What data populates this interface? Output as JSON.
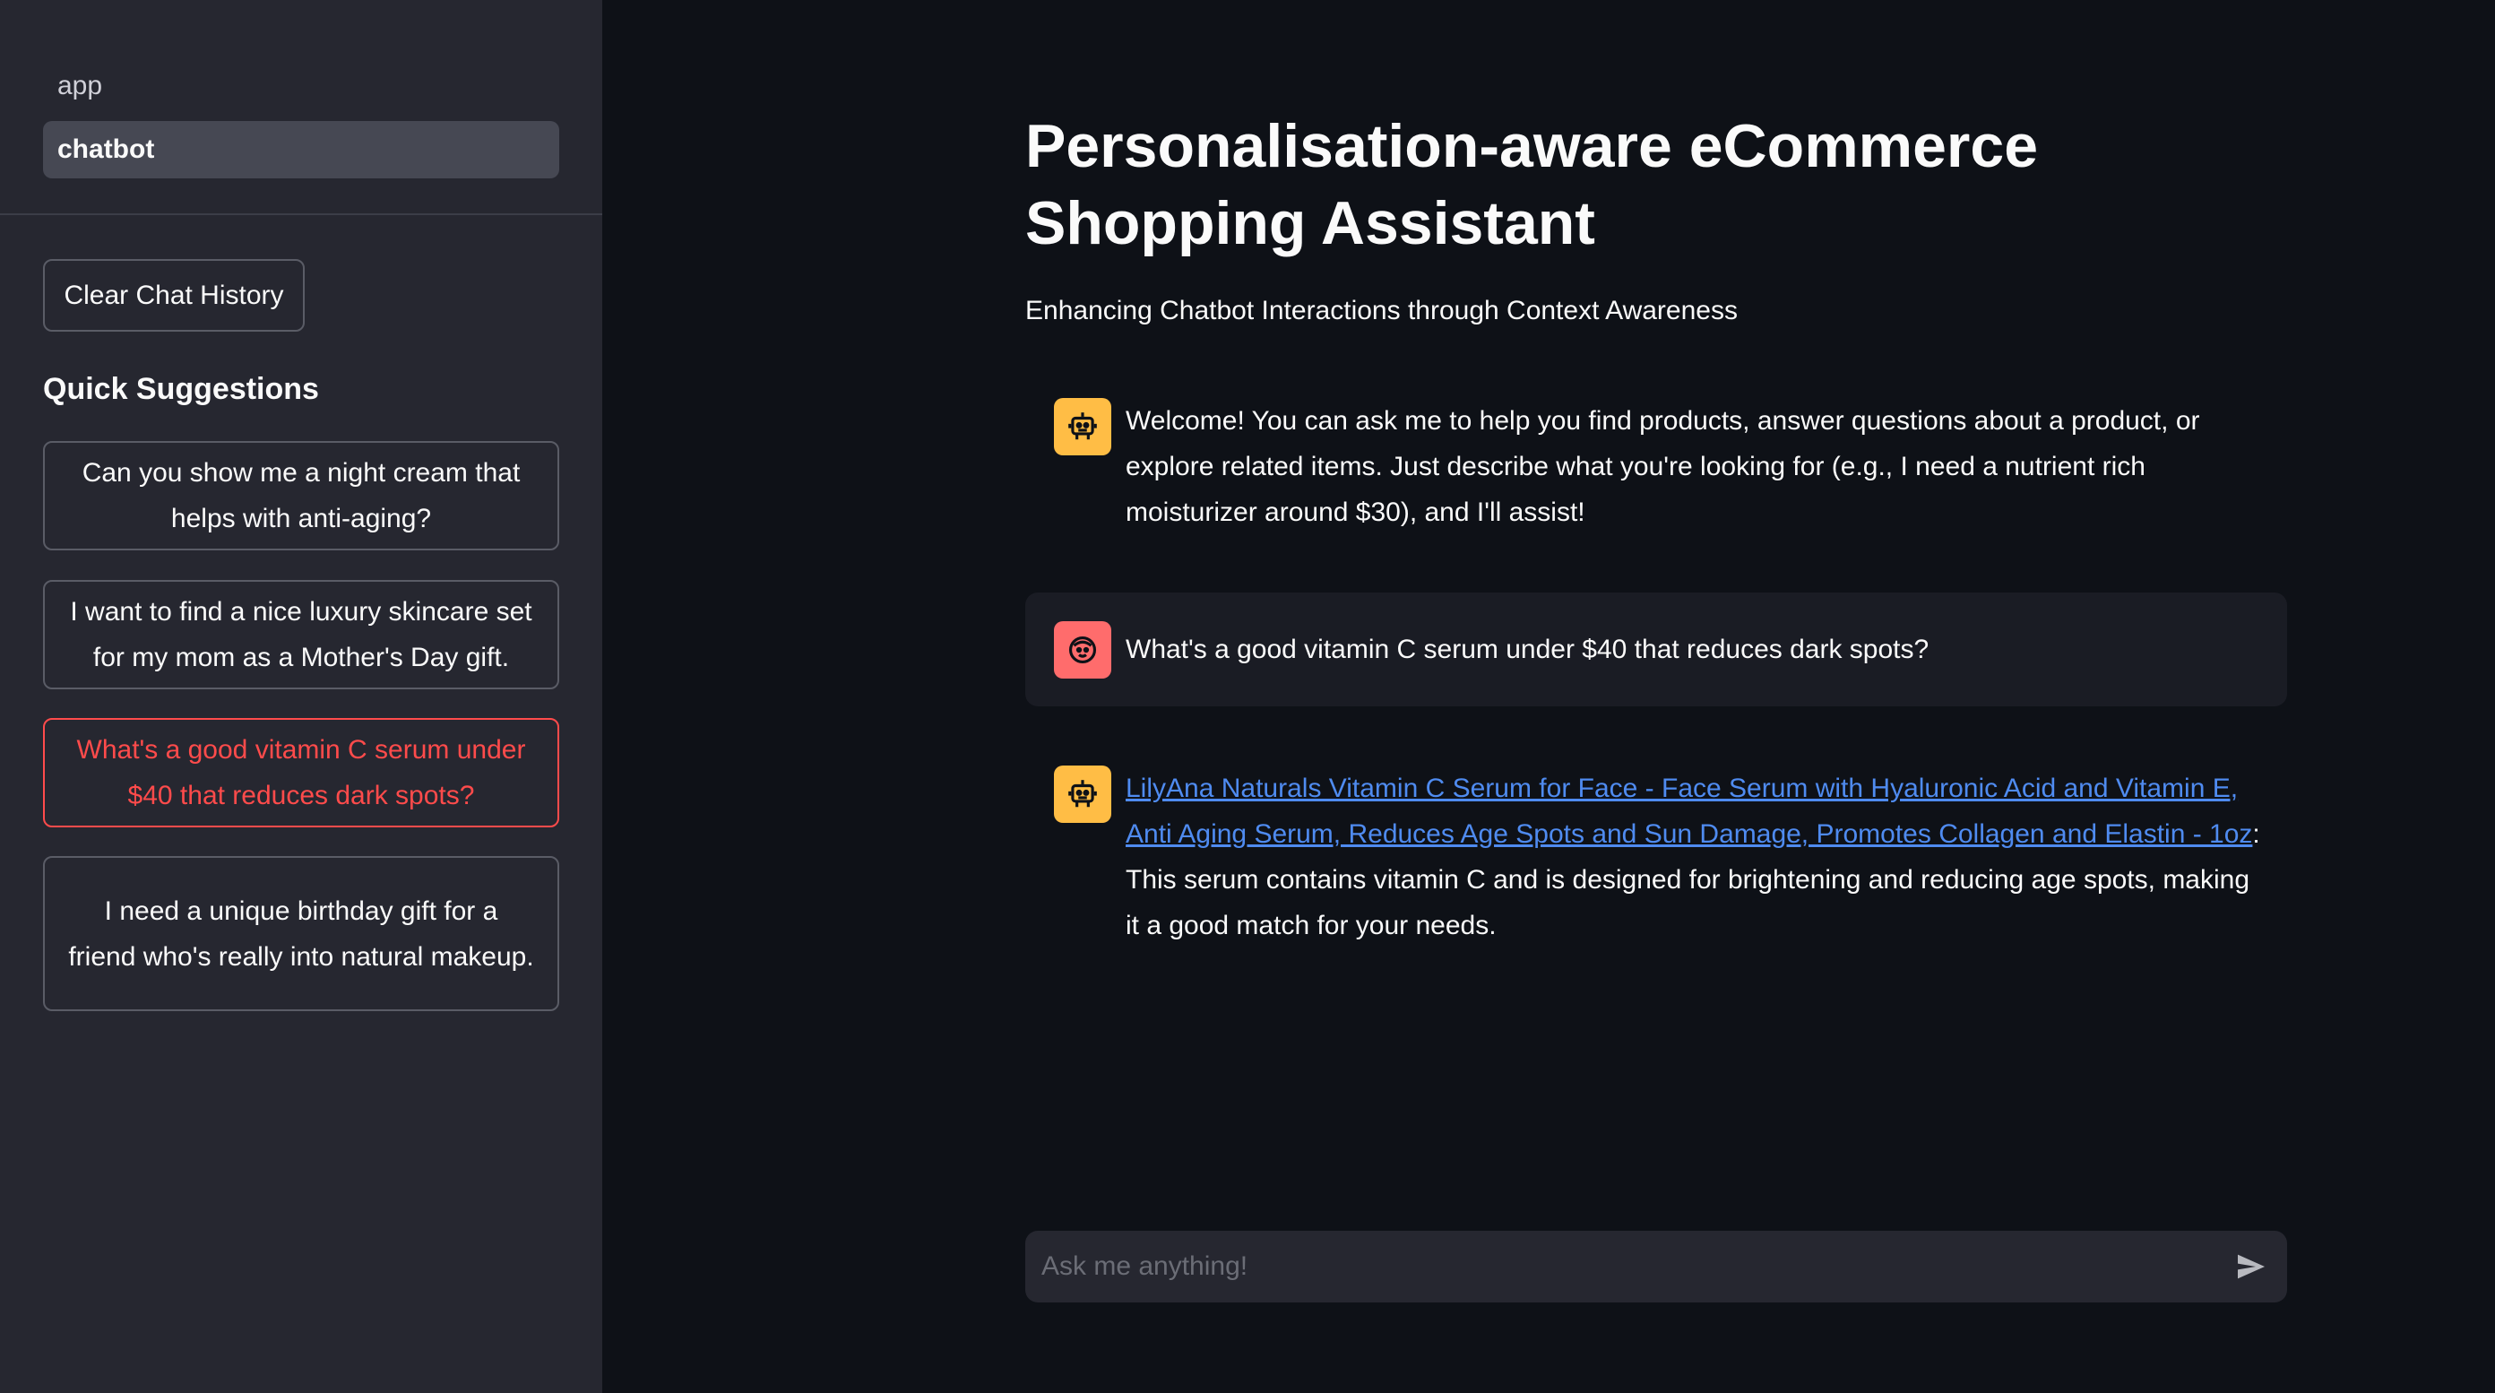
{
  "sidebar": {
    "nav": [
      {
        "label": "app",
        "active": false
      },
      {
        "label": "chatbot",
        "active": true
      }
    ],
    "clear_button": "Clear Chat History",
    "quick_suggestions_heading": "Quick Suggestions",
    "suggestions": [
      {
        "text": "Can you show me a night cream that helps with anti-aging?",
        "active": false
      },
      {
        "text": "I want to find a nice luxury skincare set for my mom as a Mother's Day gift.",
        "active": false
      },
      {
        "text": "What's a good vitamin C serum under $40 that reduces dark spots?",
        "active": true
      },
      {
        "text": "I need a unique birthday gift for a friend who's really into natural makeup.",
        "active": false
      }
    ]
  },
  "main": {
    "title": "Personalisation-aware eCommerce Shopping Assistant",
    "subtitle": "Enhancing Chatbot Interactions through Context Awareness",
    "messages": [
      {
        "role": "assistant",
        "avatar_icon": "robot-icon",
        "text": "Welcome! You can ask me to help you find products, answer questions about a product, or explore related items. Just describe what you're looking for (e.g., I need a nutrient rich moisturizer around $30), and I'll assist!"
      },
      {
        "role": "user",
        "avatar_icon": "face-icon",
        "text": "What's a good vitamin C serum under $40 that reduces dark spots?"
      },
      {
        "role": "assistant",
        "avatar_icon": "robot-icon",
        "link_text": "LilyAna Naturals Vitamin C Serum for Face - Face Serum with Hyaluronic Acid and Vitamin E, Anti Aging Serum, Reduces Age Spots and Sun Damage, Promotes Collagen and Elastin - 1oz",
        "text": ": This serum contains vitamin C and is designed for brightening and reducing age spots, making it a good match for your needs."
      }
    ],
    "chat_input": {
      "placeholder": "Ask me anything!",
      "value": ""
    }
  },
  "colors": {
    "background": "#0e1117",
    "sidebar": "#262730",
    "accent": "#ff4b4b",
    "bot_avatar": "#ffbd45",
    "user_avatar": "#ff6c6c",
    "link": "#4f8bf0"
  }
}
